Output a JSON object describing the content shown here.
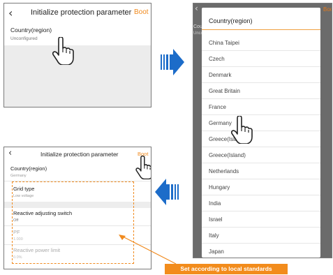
{
  "panel_top": {
    "title": "Initialize protection parameter",
    "boot": "Boot",
    "field_label": "Country(region)",
    "field_value": "Unconfigured"
  },
  "dialog": {
    "title": "Country(region)",
    "behind_label": "Cou",
    "behind_value": "Unco",
    "boot": "Boo",
    "options": [
      "China Taipei",
      "Czech",
      "Denmark",
      "Great Britain",
      "France",
      "Germany",
      "Greece(Island)",
      "Greece(Island)",
      "Netherlands",
      "Hungary",
      "India",
      "Israel",
      "Italy",
      "Japan"
    ]
  },
  "panel_bottom": {
    "title": "Initialize protection parameter",
    "boot": "Boot",
    "country_label": "Country(region)",
    "country_value": "Germany",
    "grid_label": "Grid type",
    "grid_value": "Low voltage",
    "reactive_label": "Reactive adjusting switch",
    "reactive_value": "Off",
    "pf_label": "PF",
    "pf_value": "1.000",
    "rpl_label": "Reactive power limit",
    "rpl_value": "0.0%"
  },
  "callout": "Set according to local standards",
  "colors": {
    "accent": "#f08a1e",
    "arrow": "#1c6cc9",
    "callout": "#f28c1c"
  }
}
